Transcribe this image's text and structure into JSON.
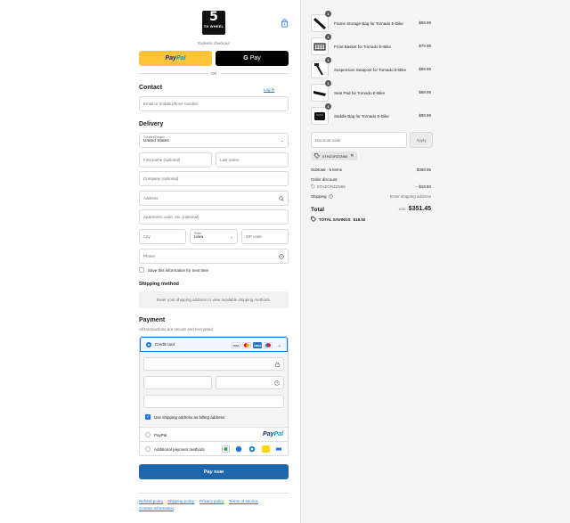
{
  "header": {
    "logo_big": "5",
    "logo_small": "TH WHEEL"
  },
  "express": {
    "label": "Express checkout",
    "paypal_a": "Pay",
    "paypal_b": "Pal",
    "gpay_label": "Pay",
    "or_label": "OR"
  },
  "contact": {
    "heading": "Contact",
    "login_label": "Log in",
    "email_placeholder": "Email or mobile phone number"
  },
  "delivery": {
    "heading": "Delivery",
    "country_label": "Country/Region",
    "country_value": "United States",
    "first_name": "First name (optional)",
    "last_name": "Last name",
    "company": "Company (optional)",
    "address": "Address",
    "apartment": "Apartment, suite, etc. (optional)",
    "city": "City",
    "state_label": "State",
    "state_value": "Iowa",
    "zip": "ZIP code",
    "phone": "Phone",
    "save_info": "Save this information for next time"
  },
  "shipping": {
    "heading": "Shipping method",
    "info": "Enter your shipping address to view available shipping methods."
  },
  "payment": {
    "heading": "Payment",
    "subtitle": "All transactions are secure and encrypted.",
    "credit_card_label": "Credit card",
    "card_brands": [
      "VISA",
      "MC",
      "AMEX",
      "MAE",
      "+4"
    ],
    "billing_same": "Use shipping address as billing address",
    "paypal_label": "PayPal",
    "paypal_logo_a": "Pay",
    "paypal_logo_b": "Pal",
    "additional_label": "Additional payment methods",
    "pay_now": "Pay now"
  },
  "footer": {
    "links": [
      "Refund policy",
      "Shipping policy",
      "Privacy policy",
      "Terms of service",
      "Contact information"
    ]
  },
  "order": {
    "items": [
      {
        "name": "Frame Storage Bag for Tornado E-Bike",
        "qty": "1",
        "price": "$59.99"
      },
      {
        "name": "Front Basket for Tornado E-Bike",
        "qty": "1",
        "price": "$79.99"
      },
      {
        "name": "Suspension Seatpost for Tornado E-Bike",
        "qty": "1",
        "price": "$59.99"
      },
      {
        "name": "Seat Pad for Tornado E-Bike",
        "qty": "1",
        "price": "$69.99"
      },
      {
        "name": "Saddle Bag for Tornado E-Bike",
        "qty": "1",
        "price": "$99.99"
      }
    ],
    "discount_placeholder": "Discount code",
    "apply_label": "Apply",
    "applied_code": "5THZGRZZN66",
    "subtotal_label": "Subtotal · 5 items",
    "subtotal_value": "$369.95",
    "order_discount_label": "Order discount",
    "discount_code_line": "5THZGRZZN66",
    "discount_value": "− $18.50",
    "shipping_label": "Shipping",
    "shipping_value": "Enter shipping address",
    "total_label": "Total",
    "total_currency": "USD",
    "total_value": "$351.45",
    "savings_label": "TOTAL SAVINGS",
    "savings_value": "$18.50"
  }
}
